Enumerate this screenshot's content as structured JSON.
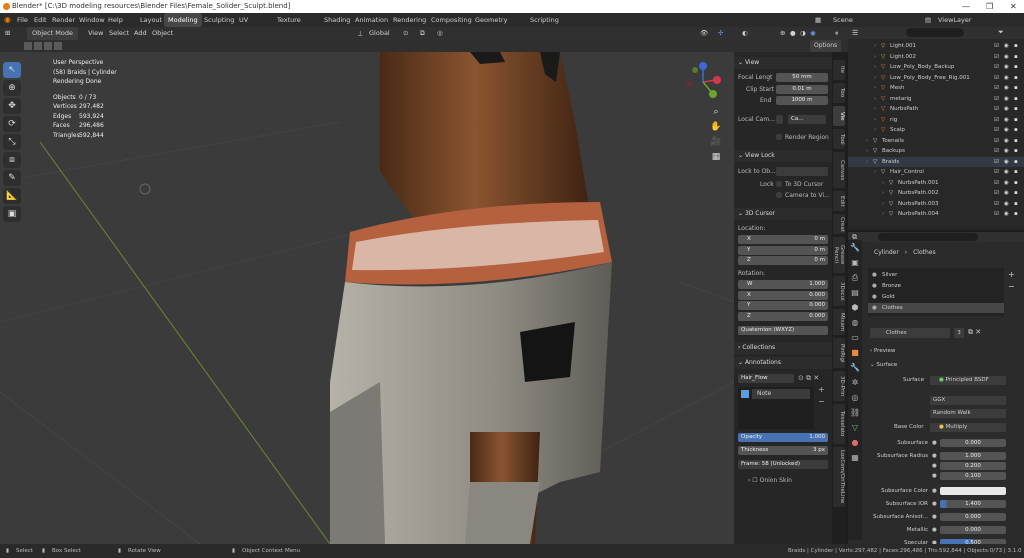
{
  "title": "Blender* [C:\\3D modeling resources\\Blender Files\\Female_Solider_Sculpt.blend]",
  "menu": [
    "File",
    "Edit",
    "Render",
    "Window",
    "Help"
  ],
  "workspaces": [
    "Layout",
    "Modeling",
    "Sculpting",
    "UV Editing",
    "Texture Paint",
    "Shading",
    "Animation",
    "Rendering",
    "Compositing",
    "Geometry Nodes",
    "Scripting"
  ],
  "active_workspace": "Modeling",
  "scene": "Scene",
  "view_layer": "ViewLayer",
  "viewport_header": {
    "mode": "Object Mode",
    "items": [
      "View",
      "Select",
      "Add",
      "Object"
    ],
    "orientation": "Global",
    "options": "Options"
  },
  "viewport_info": {
    "view": "User Perspective",
    "object": "(58) Braids | Cylinder",
    "status": "Rendering Done",
    "stats": [
      {
        "k": "Objects",
        "v": "0 / 73"
      },
      {
        "k": "Vertices",
        "v": "297,482"
      },
      {
        "k": "Edges",
        "v": "593,924"
      },
      {
        "k": "Faces",
        "v": "296,486"
      },
      {
        "k": "Triangles",
        "v": "592,844"
      }
    ]
  },
  "npanel": {
    "view_header": "View",
    "focal_label": "Focal Lengt",
    "focal_value": "50 mm",
    "clip_start_label": "Clip Start",
    "clip_start_value": "0.01 m",
    "end_label": "End",
    "end_value": "1000 m",
    "local_cam_label": "Local Cam...",
    "local_cam_value": "Ca...",
    "render_region": "Render Region",
    "view_lock_header": "View Lock",
    "lock_to_label": "Lock to Ob...",
    "lock_label": "Lock",
    "to_cursor": "To 3D Cursor",
    "camera_to_view": "Camera to Vi...",
    "cursor_header": "3D Cursor",
    "location_label": "Location:",
    "location": [
      {
        "axis": "X",
        "v": "0 m"
      },
      {
        "axis": "Y",
        "v": "0 m"
      },
      {
        "axis": "Z",
        "v": "0 m"
      }
    ],
    "rotation_label": "Rotation:",
    "rotation": [
      {
        "axis": "W",
        "v": "1.000"
      },
      {
        "axis": "X",
        "v": "0.000"
      },
      {
        "axis": "Y",
        "v": "0.000"
      },
      {
        "axis": "Z",
        "v": "0.000"
      }
    ],
    "rotation_mode": "Quaternion (WXYZ)",
    "collections_header": "Collections",
    "annotations_header": "Annotations",
    "annotation_name": "Hair_Flow",
    "note_layer": "Note",
    "opacity_label": "Opacity",
    "opacity_value": "1.000",
    "thickness_label": "Thickness",
    "thickness_value": "3 px",
    "frame": "Frame: 58 (Unlocked)",
    "onion": "Onion Skin"
  },
  "ntabs": [
    "Ite",
    "Too",
    "Vie",
    "Tool",
    "Canvas",
    "Edit",
    "Creat",
    "Grease Pencil",
    "3Dscul",
    "Mixam",
    "PinRigi",
    "3D-Prin",
    "Tesselato",
    "LoxCom/OnTheLine"
  ],
  "outliner": [
    {
      "name": "Light.001",
      "indent": 2,
      "color": "#e6b35c"
    },
    {
      "name": "Light.002",
      "indent": 2,
      "color": "#e6b35c"
    },
    {
      "name": "Low_Poly_Body_Backup",
      "indent": 2,
      "color": "#e68b4c"
    },
    {
      "name": "Low_Poly_Body_Free_Rig.001",
      "indent": 2,
      "color": "#e68b4c"
    },
    {
      "name": "Mesh",
      "indent": 2,
      "color": "#e68b4c"
    },
    {
      "name": "metarig",
      "indent": 2,
      "color": "#e68b4c"
    },
    {
      "name": "NurbsPath",
      "indent": 2,
      "color": "#e68b4c"
    },
    {
      "name": "rig",
      "indent": 2,
      "color": "#e68b4c"
    },
    {
      "name": "Scalp",
      "indent": 2,
      "color": "#e68b4c"
    },
    {
      "name": "Toenails",
      "indent": 1,
      "color": "#cfcfcf"
    },
    {
      "name": "Backups",
      "indent": 1,
      "color": "#cfcfcf"
    },
    {
      "name": "Braids",
      "indent": 1,
      "color": "#cfcfcf"
    },
    {
      "name": "Hair_Control",
      "indent": 2,
      "color": "#cfcfcf"
    },
    {
      "name": "NurbsPath.001",
      "indent": 3,
      "color": "#cfcfcf"
    },
    {
      "name": "NurbsPath.002",
      "indent": 3,
      "color": "#cfcfcf"
    },
    {
      "name": "NurbsPath.003",
      "indent": 3,
      "color": "#cfcfcf"
    },
    {
      "name": "NurbsPath.004",
      "indent": 3,
      "color": "#cfcfcf"
    }
  ],
  "props": {
    "breadcrumb_object": "Cylinder",
    "breadcrumb_material": "Clothes",
    "slots": [
      "Silver",
      "Bronze",
      "Gold",
      "Clothes"
    ],
    "material_name": "Clothes",
    "users": "3",
    "preview": "Preview",
    "surface_header": "Surface",
    "surface_label": "Surface",
    "surface_value": "Principled BSDF",
    "distribution": "GGX",
    "subsurface_method": "Random Walk",
    "base_color_label": "Base Color",
    "base_color_value": "Multiply",
    "rows": [
      {
        "k": "Subsurface",
        "v": "0.000"
      },
      {
        "k": "Subsurface Radius",
        "v": "1.000"
      },
      {
        "k": "",
        "v": "0.200"
      },
      {
        "k": "",
        "v": "0.100"
      },
      {
        "k": "Subsurface Color",
        "v": ""
      },
      {
        "k": "Subsurface IOR",
        "v": "1.400"
      },
      {
        "k": "Subsurface Anisot...",
        "v": "0.000"
      },
      {
        "k": "Metallic",
        "v": "0.000"
      },
      {
        "k": "Specular",
        "v": "0.500"
      }
    ]
  },
  "status": {
    "left": [
      "Select",
      "Box Select",
      "Rotate View",
      "Object Context Menu"
    ],
    "right": "Braids | Cylinder | Verts:297,482 | Faces:296,486 | Tris:592,844 | Objects:0/73 | 3.1.0"
  },
  "colors": {
    "accent": "#4772b3",
    "header": "#303030",
    "panel": "#262626",
    "skin": "#7a4a2a",
    "cloth": "#8a8a80"
  }
}
